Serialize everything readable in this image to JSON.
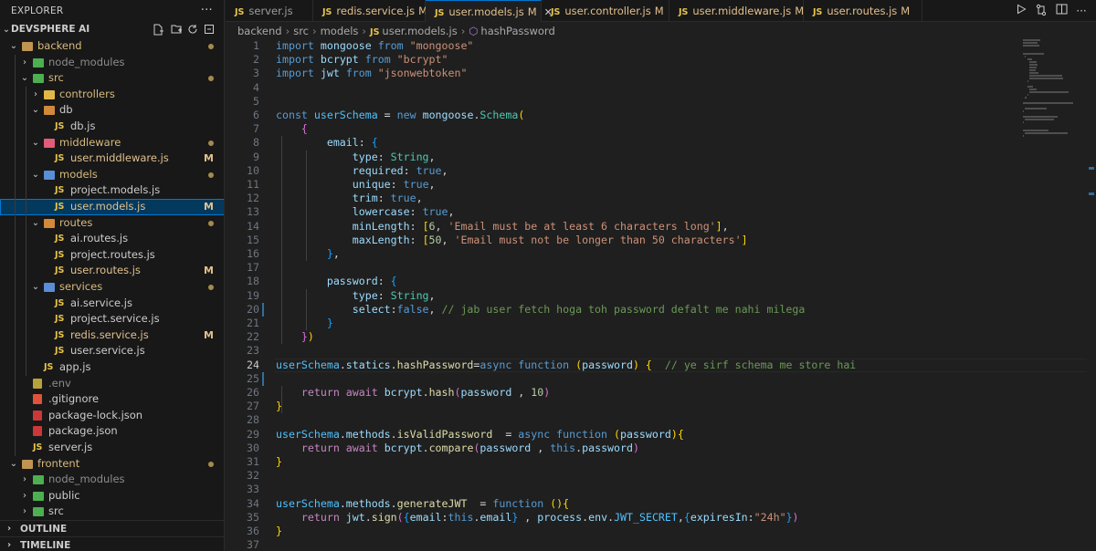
{
  "sidebar": {
    "title": "EXPLORER",
    "project": "DEVSPHERE AI",
    "tree": [
      {
        "label": "backend",
        "kind": "folder",
        "depth": 0,
        "open": true,
        "icon": "folder-brown",
        "status": "dot"
      },
      {
        "label": "node_modules",
        "kind": "folder",
        "depth": 1,
        "open": false,
        "icon": "folder-green",
        "dim": true
      },
      {
        "label": "src",
        "kind": "folder",
        "depth": 1,
        "open": true,
        "icon": "folder-green",
        "status": "dot"
      },
      {
        "label": "controllers",
        "kind": "folder",
        "depth": 2,
        "open": false,
        "icon": "folder-yellow"
      },
      {
        "label": "db",
        "kind": "folder",
        "depth": 2,
        "open": true,
        "icon": "folder-orange"
      },
      {
        "label": "db.js",
        "kind": "js",
        "depth": 3
      },
      {
        "label": "middleware",
        "kind": "folder",
        "depth": 2,
        "open": true,
        "icon": "folder-pink",
        "status": "dot"
      },
      {
        "label": "user.middleware.js",
        "kind": "js",
        "depth": 3,
        "status": "M",
        "modified": true
      },
      {
        "label": "models",
        "kind": "folder",
        "depth": 2,
        "open": true,
        "icon": "folder-blue",
        "status": "dot"
      },
      {
        "label": "project.models.js",
        "kind": "js",
        "depth": 3
      },
      {
        "label": "user.models.js",
        "kind": "js",
        "depth": 3,
        "status": "M",
        "modified": true,
        "selected": true
      },
      {
        "label": "routes",
        "kind": "folder",
        "depth": 2,
        "open": true,
        "icon": "folder-orange",
        "status": "dot"
      },
      {
        "label": "ai.routes.js",
        "kind": "js",
        "depth": 3
      },
      {
        "label": "project.routes.js",
        "kind": "js",
        "depth": 3
      },
      {
        "label": "user.routes.js",
        "kind": "js",
        "depth": 3,
        "status": "M",
        "modified": true
      },
      {
        "label": "services",
        "kind": "folder",
        "depth": 2,
        "open": true,
        "icon": "folder-blue",
        "status": "dot"
      },
      {
        "label": "ai.service.js",
        "kind": "js",
        "depth": 3
      },
      {
        "label": "project.service.js",
        "kind": "js",
        "depth": 3
      },
      {
        "label": "redis.service.js",
        "kind": "js",
        "depth": 3,
        "status": "M",
        "modified": true
      },
      {
        "label": "user.service.js",
        "kind": "js",
        "depth": 3
      },
      {
        "label": "app.js",
        "kind": "js",
        "depth": 2
      },
      {
        "label": ".env",
        "kind": "env",
        "depth": 1,
        "dim": true
      },
      {
        "label": ".gitignore",
        "kind": "git",
        "depth": 1
      },
      {
        "label": "package-lock.json",
        "kind": "npm",
        "depth": 1
      },
      {
        "label": "package.json",
        "kind": "npm",
        "depth": 1
      },
      {
        "label": "server.js",
        "kind": "js",
        "depth": 1
      },
      {
        "label": "frontent",
        "kind": "folder",
        "depth": 0,
        "open": true,
        "icon": "folder-brown",
        "status": "dot"
      },
      {
        "label": "node_modules",
        "kind": "folder",
        "depth": 1,
        "open": false,
        "icon": "folder-green",
        "dim": true
      },
      {
        "label": "public",
        "kind": "folder",
        "depth": 1,
        "open": false,
        "icon": "folder-green"
      },
      {
        "label": "src",
        "kind": "folder",
        "depth": 1,
        "open": false,
        "icon": "folder-green"
      }
    ],
    "sections": [
      "OUTLINE",
      "TIMELINE"
    ],
    "more": "···"
  },
  "tabs": [
    {
      "name": "server.js",
      "modified": false
    },
    {
      "name": "redis.service.js",
      "modified": true,
      "mark": "M"
    },
    {
      "name": "user.models.js",
      "modified": true,
      "mark": "M",
      "active": true
    },
    {
      "name": "user.controller.js",
      "modified": true,
      "mark": "M"
    },
    {
      "name": "user.middleware.js",
      "modified": true,
      "mark": "M"
    },
    {
      "name": "user.routes.js",
      "modified": true,
      "mark": "M"
    }
  ],
  "tab_icon_text": "JS",
  "breadcrumb": [
    "backend",
    "src",
    "models",
    "user.models.js",
    "hashPassword"
  ],
  "current_line": 24,
  "code": [
    [
      [
        "kw",
        "import"
      ],
      [
        "pun",
        " "
      ],
      [
        "id",
        "mongoose"
      ],
      [
        "pun",
        " "
      ],
      [
        "kw",
        "from"
      ],
      [
        "pun",
        " "
      ],
      [
        "str",
        "\"mongoose\""
      ]
    ],
    [
      [
        "kw",
        "import"
      ],
      [
        "pun",
        " "
      ],
      [
        "id",
        "bcrypt"
      ],
      [
        "pun",
        " "
      ],
      [
        "kw",
        "from"
      ],
      [
        "pun",
        " "
      ],
      [
        "str",
        "\"bcrypt\""
      ]
    ],
    [
      [
        "kw",
        "import"
      ],
      [
        "pun",
        " "
      ],
      [
        "id",
        "jwt"
      ],
      [
        "pun",
        " "
      ],
      [
        "kw",
        "from"
      ],
      [
        "pun",
        " "
      ],
      [
        "str",
        "\"jsonwebtoken\""
      ]
    ],
    [],
    [],
    [
      [
        "kw",
        "const"
      ],
      [
        "pun",
        " "
      ],
      [
        "cst",
        "userSchema"
      ],
      [
        "pun",
        " = "
      ],
      [
        "kw",
        "new"
      ],
      [
        "pun",
        " "
      ],
      [
        "id",
        "mongoose"
      ],
      [
        "pun",
        "."
      ],
      [
        "cls",
        "Schema"
      ],
      [
        "b1",
        "("
      ]
    ],
    [
      [
        "pun",
        "    "
      ],
      [
        "b2",
        "{"
      ]
    ],
    [
      [
        "pun",
        "        "
      ],
      [
        "id",
        "email"
      ],
      [
        "pun",
        ": "
      ],
      [
        "b3",
        "{"
      ]
    ],
    [
      [
        "pun",
        "            "
      ],
      [
        "id",
        "type"
      ],
      [
        "pun",
        ": "
      ],
      [
        "cls",
        "String"
      ],
      [
        "pun",
        ","
      ]
    ],
    [
      [
        "pun",
        "            "
      ],
      [
        "id",
        "required"
      ],
      [
        "pun",
        ": "
      ],
      [
        "kw",
        "true"
      ],
      [
        "pun",
        ","
      ]
    ],
    [
      [
        "pun",
        "            "
      ],
      [
        "id",
        "unique"
      ],
      [
        "pun",
        ": "
      ],
      [
        "kw",
        "true"
      ],
      [
        "pun",
        ","
      ]
    ],
    [
      [
        "pun",
        "            "
      ],
      [
        "id",
        "trim"
      ],
      [
        "pun",
        ": "
      ],
      [
        "kw",
        "true"
      ],
      [
        "pun",
        ","
      ]
    ],
    [
      [
        "pun",
        "            "
      ],
      [
        "id",
        "lowercase"
      ],
      [
        "pun",
        ": "
      ],
      [
        "kw",
        "true"
      ],
      [
        "pun",
        ","
      ]
    ],
    [
      [
        "pun",
        "            "
      ],
      [
        "id",
        "minLength"
      ],
      [
        "pun",
        ": "
      ],
      [
        "b1",
        "["
      ],
      [
        "num",
        "6"
      ],
      [
        "pun",
        ", "
      ],
      [
        "str",
        "'Email must be at least 6 characters long'"
      ],
      [
        "b1",
        "]"
      ],
      [
        "pun",
        ","
      ]
    ],
    [
      [
        "pun",
        "            "
      ],
      [
        "id",
        "maxLength"
      ],
      [
        "pun",
        ": "
      ],
      [
        "b1",
        "["
      ],
      [
        "num",
        "50"
      ],
      [
        "pun",
        ", "
      ],
      [
        "str",
        "'Email must not be longer than 50 characters'"
      ],
      [
        "b1",
        "]"
      ]
    ],
    [
      [
        "pun",
        "        "
      ],
      [
        "b3",
        "}"
      ],
      [
        "pun",
        ","
      ]
    ],
    [],
    [
      [
        "pun",
        "        "
      ],
      [
        "id",
        "password"
      ],
      [
        "pun",
        ": "
      ],
      [
        "b3",
        "{"
      ]
    ],
    [
      [
        "pun",
        "            "
      ],
      [
        "id",
        "type"
      ],
      [
        "pun",
        ": "
      ],
      [
        "cls",
        "String"
      ],
      [
        "pun",
        ","
      ]
    ],
    [
      [
        "pun",
        "            "
      ],
      [
        "id",
        "select"
      ],
      [
        "pun",
        ":"
      ],
      [
        "kw",
        "false"
      ],
      [
        "pun",
        ", "
      ],
      [
        "cmt",
        "// jab user fetch hoga toh password defalt me nahi milega"
      ]
    ],
    [
      [
        "pun",
        "        "
      ],
      [
        "b3",
        "}"
      ]
    ],
    [
      [
        "pun",
        "    "
      ],
      [
        "b2",
        "}"
      ],
      [
        "b1",
        ")"
      ]
    ],
    [],
    [
      [
        "cst",
        "userSchema"
      ],
      [
        "pun",
        "."
      ],
      [
        "id",
        "statics"
      ],
      [
        "pun",
        "."
      ],
      [
        "fnc",
        "hashPassword"
      ],
      [
        "pun",
        "="
      ],
      [
        "kw",
        "async"
      ],
      [
        "pun",
        " "
      ],
      [
        "kw",
        "function"
      ],
      [
        "pun",
        " "
      ],
      [
        "b1",
        "("
      ],
      [
        "id",
        "password"
      ],
      [
        "b1",
        ")"
      ],
      [
        "pun",
        " "
      ],
      [
        "b1",
        "{"
      ],
      [
        "pun",
        "  "
      ],
      [
        "cmt",
        "// ye sirf schema me store hai"
      ]
    ],
    [],
    [
      [
        "pun",
        "    "
      ],
      [
        "ctl",
        "return"
      ],
      [
        "pun",
        " "
      ],
      [
        "ctl",
        "await"
      ],
      [
        "pun",
        " "
      ],
      [
        "id",
        "bcrypt"
      ],
      [
        "pun",
        "."
      ],
      [
        "fnc",
        "hash"
      ],
      [
        "b2",
        "("
      ],
      [
        "id",
        "password"
      ],
      [
        "pun",
        " , "
      ],
      [
        "num",
        "10"
      ],
      [
        "b2",
        ")"
      ]
    ],
    [
      [
        "b1",
        "}"
      ]
    ],
    [],
    [
      [
        "cst",
        "userSchema"
      ],
      [
        "pun",
        "."
      ],
      [
        "id",
        "methods"
      ],
      [
        "pun",
        "."
      ],
      [
        "fnc",
        "isValidPassword"
      ],
      [
        "pun",
        "  = "
      ],
      [
        "kw",
        "async"
      ],
      [
        "pun",
        " "
      ],
      [
        "kw",
        "function"
      ],
      [
        "pun",
        " "
      ],
      [
        "b1",
        "("
      ],
      [
        "id",
        "password"
      ],
      [
        "b1",
        ")"
      ],
      [
        "b1",
        "{"
      ]
    ],
    [
      [
        "pun",
        "    "
      ],
      [
        "ctl",
        "return"
      ],
      [
        "pun",
        " "
      ],
      [
        "ctl",
        "await"
      ],
      [
        "pun",
        " "
      ],
      [
        "id",
        "bcrypt"
      ],
      [
        "pun",
        "."
      ],
      [
        "fnc",
        "compare"
      ],
      [
        "b2",
        "("
      ],
      [
        "id",
        "password"
      ],
      [
        "pun",
        " , "
      ],
      [
        "kw",
        "this"
      ],
      [
        "pun",
        "."
      ],
      [
        "id",
        "password"
      ],
      [
        "b2",
        ")"
      ]
    ],
    [
      [
        "b1",
        "}"
      ]
    ],
    [],
    [],
    [
      [
        "cst",
        "userSchema"
      ],
      [
        "pun",
        "."
      ],
      [
        "id",
        "methods"
      ],
      [
        "pun",
        "."
      ],
      [
        "fnc",
        "generateJWT"
      ],
      [
        "pun",
        "  = "
      ],
      [
        "kw",
        "function"
      ],
      [
        "pun",
        " "
      ],
      [
        "b1",
        "()"
      ],
      [
        "b1",
        "{"
      ]
    ],
    [
      [
        "pun",
        "    "
      ],
      [
        "ctl",
        "return"
      ],
      [
        "pun",
        " "
      ],
      [
        "id",
        "jwt"
      ],
      [
        "pun",
        "."
      ],
      [
        "fnc",
        "sign"
      ],
      [
        "b2",
        "("
      ],
      [
        "b3",
        "{"
      ],
      [
        "id",
        "email"
      ],
      [
        "pun",
        ":"
      ],
      [
        "kw",
        "this"
      ],
      [
        "pun",
        "."
      ],
      [
        "id",
        "email"
      ],
      [
        "b3",
        "}"
      ],
      [
        "pun",
        " , "
      ],
      [
        "id",
        "process"
      ],
      [
        "pun",
        "."
      ],
      [
        "id",
        "env"
      ],
      [
        "pun",
        "."
      ],
      [
        "cst",
        "JWT_SECRET"
      ],
      [
        "pun",
        ","
      ],
      [
        "b3",
        "{"
      ],
      [
        "id",
        "expiresIn"
      ],
      [
        "pun",
        ":"
      ],
      [
        "str",
        "\"24h\""
      ],
      [
        "b3",
        "}"
      ],
      [
        "b2",
        ")"
      ]
    ],
    [
      [
        "b1",
        "}"
      ]
    ],
    []
  ],
  "colors": {
    "accent": "#0078d4",
    "modified": "#e2c08d",
    "js_icon": "#e8c44a"
  }
}
